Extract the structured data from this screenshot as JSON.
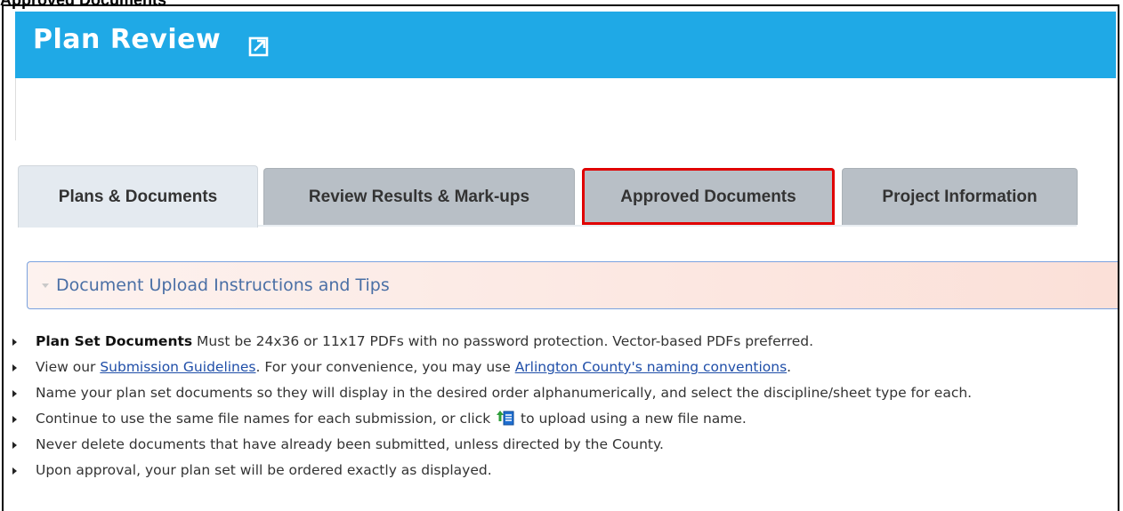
{
  "caption": "Approved Documents",
  "header": {
    "title": "Plan Review",
    "external_icon": "external-link-icon",
    "color": "#1fa9e6"
  },
  "tabs": [
    {
      "label": "Plans & Documents",
      "active": true
    },
    {
      "label": "Review Results & Mark-ups",
      "active": false
    },
    {
      "label": "Approved Documents",
      "active": false,
      "highlighted": true
    },
    {
      "label": "Project Information",
      "active": false
    }
  ],
  "accordion": {
    "title": "Document Upload Instructions and Tips",
    "arrow_icon": "caret-down-icon"
  },
  "tips": {
    "item1_bold": "Plan Set Documents",
    "item1_rest": " Must be 24x36 or 11x17 PDFs with no password protection. Vector-based PDFs preferred.",
    "item2_pre": "View our ",
    "item2_link1": "Submission Guidelines",
    "item2_mid": ". For your convenience, you may use ",
    "item2_link2": "Arlington County's naming conventions",
    "item2_post": ".",
    "item3": "Name your plan set documents so they will display in the desired order alphanumerically, and select the discipline/sheet type for each.",
    "item4_pre": "Continue to use the same file names for each submission, or click ",
    "item4_icon": "upload-new-file-icon",
    "item4_post": " to upload using a new file name.",
    "item5": "Never delete documents that have already been submitted, unless directed by the County.",
    "item6": "Upon approval, your plan set will be ordered exactly as displayed."
  },
  "colors": {
    "highlight_border": "#e00000",
    "link": "#1f4ea8",
    "accordion_text": "#4a6fa5"
  }
}
